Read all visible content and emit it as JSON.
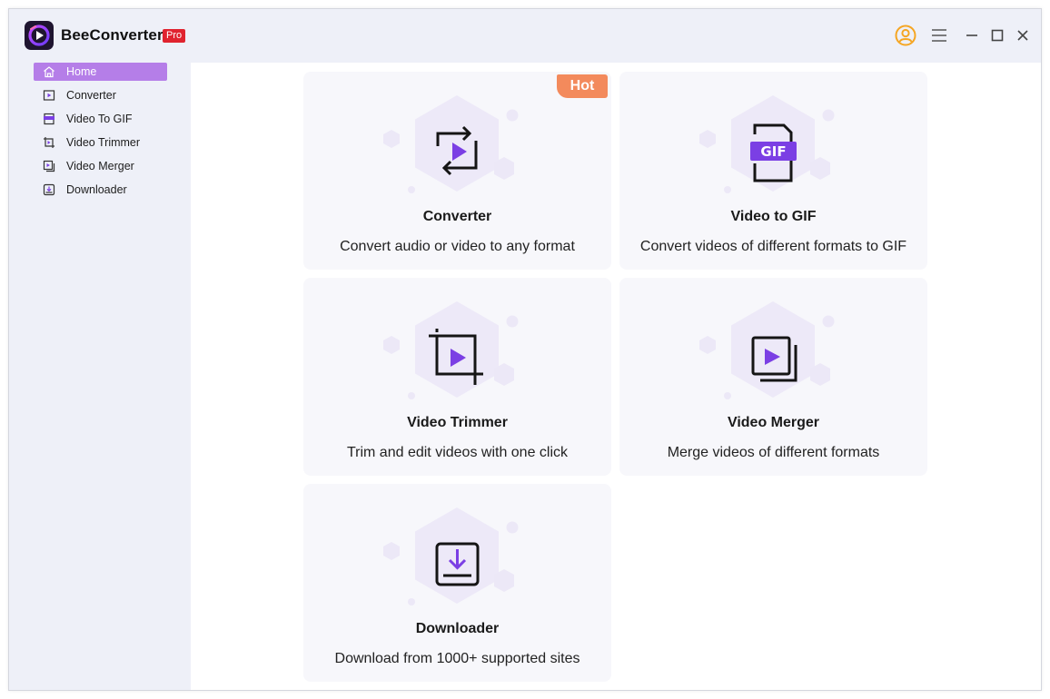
{
  "app": {
    "name": "BeeConverter",
    "badge": "Pro"
  },
  "titlebar": {
    "icons": [
      "account-icon",
      "menu-icon",
      "minimize-icon",
      "maximize-icon",
      "close-icon"
    ]
  },
  "sidebar": {
    "items": [
      {
        "label": "Home",
        "icon": "home-icon",
        "active": true
      },
      {
        "label": "Converter",
        "icon": "converter-icon",
        "active": false
      },
      {
        "label": "Video To GIF",
        "icon": "gif-icon",
        "active": false
      },
      {
        "label": "Video Trimmer",
        "icon": "trimmer-icon",
        "active": false
      },
      {
        "label": "Video Merger",
        "icon": "merger-icon",
        "active": false
      },
      {
        "label": "Downloader",
        "icon": "downloader-icon",
        "active": false
      }
    ]
  },
  "cards": [
    {
      "title": "Converter",
      "desc": "Convert audio or video to any format",
      "badge": "Hot",
      "icon": "converter-icon"
    },
    {
      "title": "Video to GIF",
      "desc": "Convert videos of different formats to GIF",
      "icon": "gif-icon"
    },
    {
      "title": "Video Trimmer",
      "desc": "Trim and edit videos with one click",
      "icon": "trimmer-icon"
    },
    {
      "title": "Video Merger",
      "desc": "Merge videos of different formats",
      "icon": "merger-icon"
    },
    {
      "title": "Downloader",
      "desc": "Download from 1000+ supported sites",
      "icon": "downloader-icon"
    }
  ],
  "colors": {
    "accent": "#7b3fe4",
    "sidebar_bg": "#eef0f8",
    "active_nav": "#b57ee8",
    "hot_badge": "#f38a5c",
    "pro_badge": "#e0232f",
    "user_icon": "#f5a623"
  }
}
